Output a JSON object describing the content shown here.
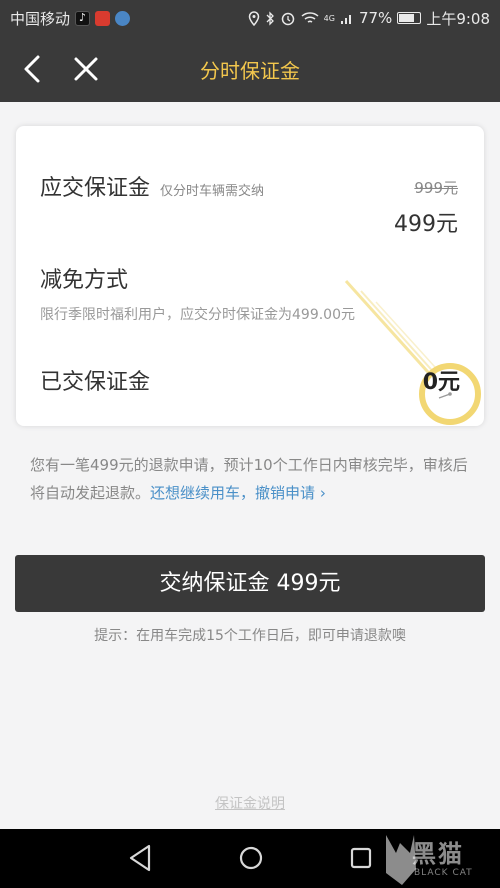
{
  "status_bar": {
    "carrier": "中国移动",
    "signal_label": "4G",
    "battery_percent": "77%",
    "battery_level": 0.77,
    "time": "上午9:08",
    "icons": [
      "tiktok-icon",
      "news-app-icon",
      "shield-app-icon",
      "location-icon",
      "bluetooth-icon",
      "alarm-icon",
      "wifi-icon",
      "signal-icon",
      "battery-icon"
    ]
  },
  "nav": {
    "title": "分时保证金",
    "title_color": "#f3c74d"
  },
  "card": {
    "deposit_label": "应交保证金",
    "deposit_hint": "仅分时车辆需交纳",
    "original_price": "999元",
    "deposit_price": "499元",
    "waiver_label": "减免方式",
    "waiver_desc": "限行季限时福利用户，应交分时保证金为499.00元",
    "paid_label": "已交保证金",
    "paid_value": "0元"
  },
  "refund_notice": {
    "text": "您有一笔499元的退款申请，预计10个工作日内审核完毕，审核后将自动发起退款。",
    "continue_link": "还想继续用车，撤销申请",
    "chevron": "›"
  },
  "pay_button": {
    "label": "交纳保证金 499元"
  },
  "tip": "提示：在用车完成15个工作日后，即可申请退款噢",
  "footer_link": "保证金说明",
  "watermark": {
    "text": "黑猫",
    "sub": "BLACK CAT"
  }
}
